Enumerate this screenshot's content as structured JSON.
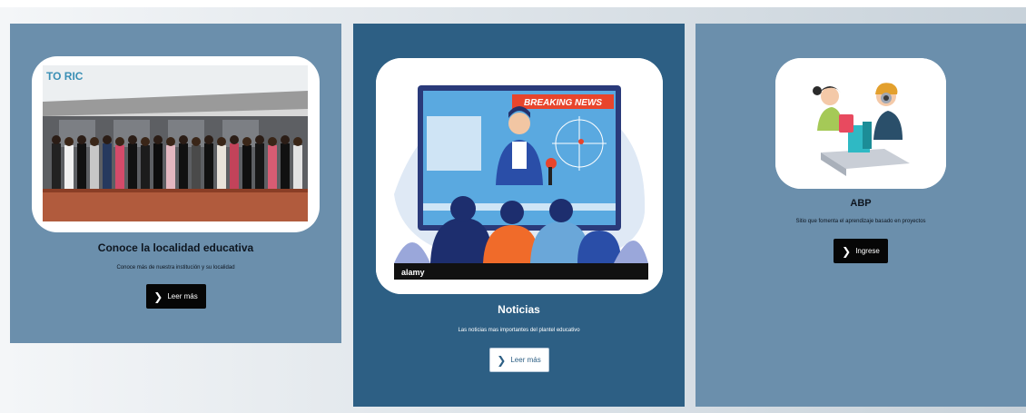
{
  "cards": [
    {
      "title": "Conoce la localidad educativa",
      "description": "Conoce más de nuestra institución y su localidad",
      "button_label": "Leer más",
      "banner_text": "TO RIC"
    },
    {
      "title": "Noticias",
      "description": "Las noticias mas importantes del plantel educativo",
      "button_label": "Leer más",
      "news_banner": "BREAKING NEWS",
      "watermark": "alamy"
    },
    {
      "title": "ABP",
      "description": "Sitio que fomenta el aprendizaje basado en proyectos",
      "button_label": "Ingrese"
    }
  ],
  "colors": {
    "card_light": "#6b8fac",
    "card_dark": "#2d5f84",
    "button_dark": "#060606",
    "button_light": "#ffffff",
    "news_red": "#e8452c"
  },
  "icons": {
    "button_icon": "chevron-right-icon"
  }
}
